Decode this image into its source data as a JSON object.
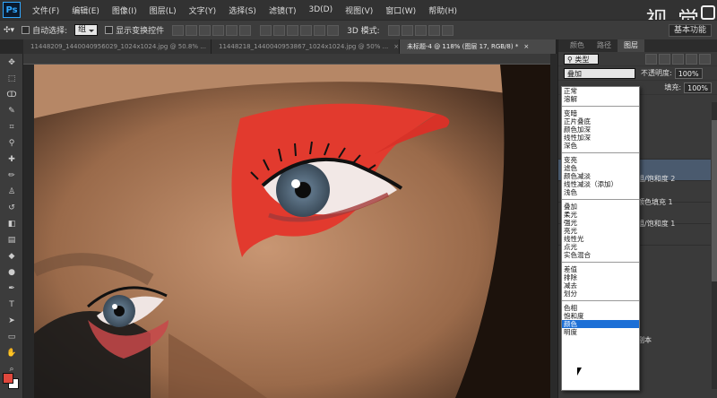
{
  "app": {
    "logo": "Ps"
  },
  "menu": [
    "文件(F)",
    "编辑(E)",
    "图像(I)",
    "图层(L)",
    "文字(Y)",
    "选择(S)",
    "滤镜(T)",
    "3D(D)",
    "视图(V)",
    "窗口(W)",
    "帮助(H)"
  ],
  "watermark": "视 觉",
  "options_bar": {
    "auto_select_label": "自动选择:",
    "auto_select_value": "组",
    "show_transform_label": "显示变换控件",
    "mode_3d_label": "3D 模式:",
    "workspace": "基本功能"
  },
  "tabs": [
    {
      "label": "11448209_1440040956029_1024x1024.jpg @ 50.8% ...",
      "close": "×",
      "active": false
    },
    {
      "label": "11448218_1440040953867_1024x1024.jpg @ 50% ...",
      "close": "×",
      "active": false
    },
    {
      "label": "未标题-4 @ 118% (图层 17, RGB/8) *",
      "close": "×",
      "active": true
    }
  ],
  "panel": {
    "tabs": [
      "颜色",
      "路径",
      "图层"
    ],
    "kind_filter": "类型",
    "blend_mode": "叠加",
    "opacity_label": "不透明度:",
    "opacity_value": "100%",
    "fill_label": "填充:",
    "fill_value": "100%",
    "layers": [
      "组/饱和度 2",
      "颜色填充 1",
      "组/饱和度 1",
      "副本"
    ]
  },
  "blend_modes": {
    "groups": [
      [
        "正常",
        "溶解"
      ],
      [
        "变暗",
        "正片叠底",
        "颜色加深",
        "线性加深",
        "深色"
      ],
      [
        "变亮",
        "滤色",
        "颜色减淡",
        "线性减淡（添加）",
        "浅色"
      ],
      [
        "叠加",
        "柔光",
        "强光",
        "亮光",
        "线性光",
        "点光",
        "实色混合"
      ],
      [
        "差值",
        "排除",
        "减去",
        "划分"
      ],
      [
        "色相",
        "饱和度",
        "颜色",
        "明度"
      ]
    ],
    "highlighted": "颜色"
  },
  "colors": {
    "foreground": "#e0483d",
    "background": "#ffffff",
    "highlight": "#1c6fd6"
  },
  "icons": [
    "move-tool-icon",
    "marquee-tool-icon",
    "lasso-tool-icon",
    "quick-select-icon",
    "crop-tool-icon",
    "eyedropper-icon",
    "healing-brush-icon",
    "brush-tool-icon",
    "clone-stamp-icon",
    "history-brush-icon",
    "eraser-icon",
    "gradient-tool-icon",
    "blur-tool-icon",
    "dodge-tool-icon",
    "pen-tool-icon",
    "type-tool-icon",
    "path-select-icon",
    "shape-tool-icon",
    "hand-tool-icon",
    "zoom-tool-icon"
  ]
}
